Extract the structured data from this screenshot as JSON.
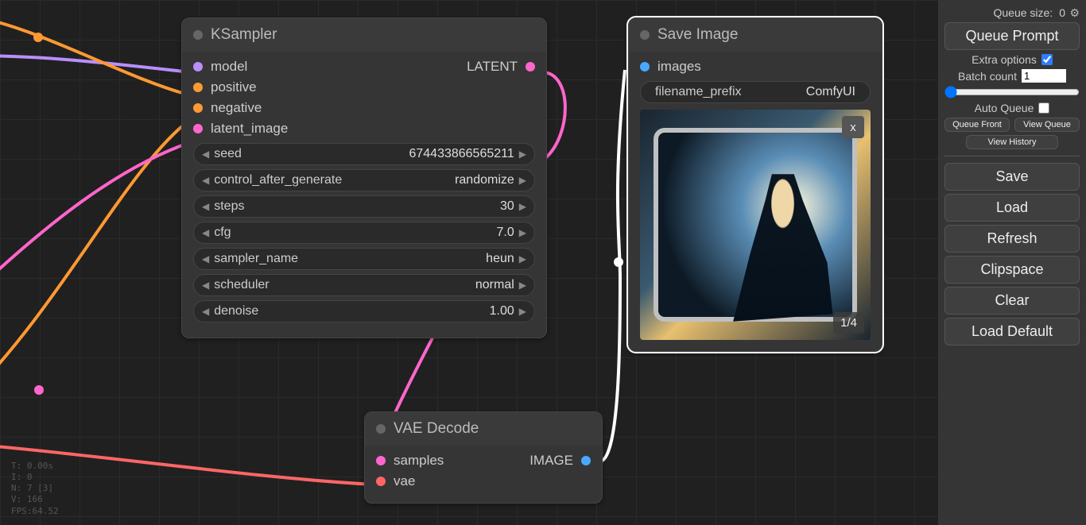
{
  "side_panel": {
    "queue_size_label": "Queue size:",
    "queue_size_value": "0",
    "queue_prompt": "Queue Prompt",
    "extra_options": "Extra options",
    "extra_options_checked": true,
    "batch_count_label": "Batch count",
    "batch_count_value": "1",
    "auto_queue": "Auto Queue",
    "auto_queue_checked": false,
    "queue_front": "Queue Front",
    "view_queue": "View Queue",
    "view_history": "View History",
    "save": "Save",
    "load": "Load",
    "refresh": "Refresh",
    "clipspace": "Clipspace",
    "clear": "Clear",
    "load_default": "Load Default"
  },
  "nodes": {
    "ksampler": {
      "title": "KSampler",
      "inputs": {
        "model": "model",
        "positive": "positive",
        "negative": "negative",
        "latent_image": "latent_image"
      },
      "outputs": {
        "latent": "LATENT"
      },
      "widgets": {
        "seed": {
          "name": "seed",
          "value": "674433866565211"
        },
        "control_after_generate": {
          "name": "control_after_generate",
          "value": "randomize"
        },
        "steps": {
          "name": "steps",
          "value": "30"
        },
        "cfg": {
          "name": "cfg",
          "value": "7.0"
        },
        "sampler_name": {
          "name": "sampler_name",
          "value": "heun"
        },
        "scheduler": {
          "name": "scheduler",
          "value": "normal"
        },
        "denoise": {
          "name": "denoise",
          "value": "1.00"
        }
      }
    },
    "vae_decode": {
      "title": "VAE Decode",
      "inputs": {
        "samples": "samples",
        "vae": "vae"
      },
      "outputs": {
        "image": "IMAGE"
      }
    },
    "save_image": {
      "title": "Save Image",
      "inputs": {
        "images": "images"
      },
      "widgets": {
        "filename_prefix": {
          "name": "filename_prefix",
          "value": "ComfyUI"
        }
      },
      "close_label": "x",
      "counter": "1/4"
    }
  },
  "debug": {
    "t": "T: 0.00s",
    "i": "I: 0",
    "n": "N: 7 [3]",
    "v": "V: 166",
    "fps": "FPS:64.52"
  }
}
